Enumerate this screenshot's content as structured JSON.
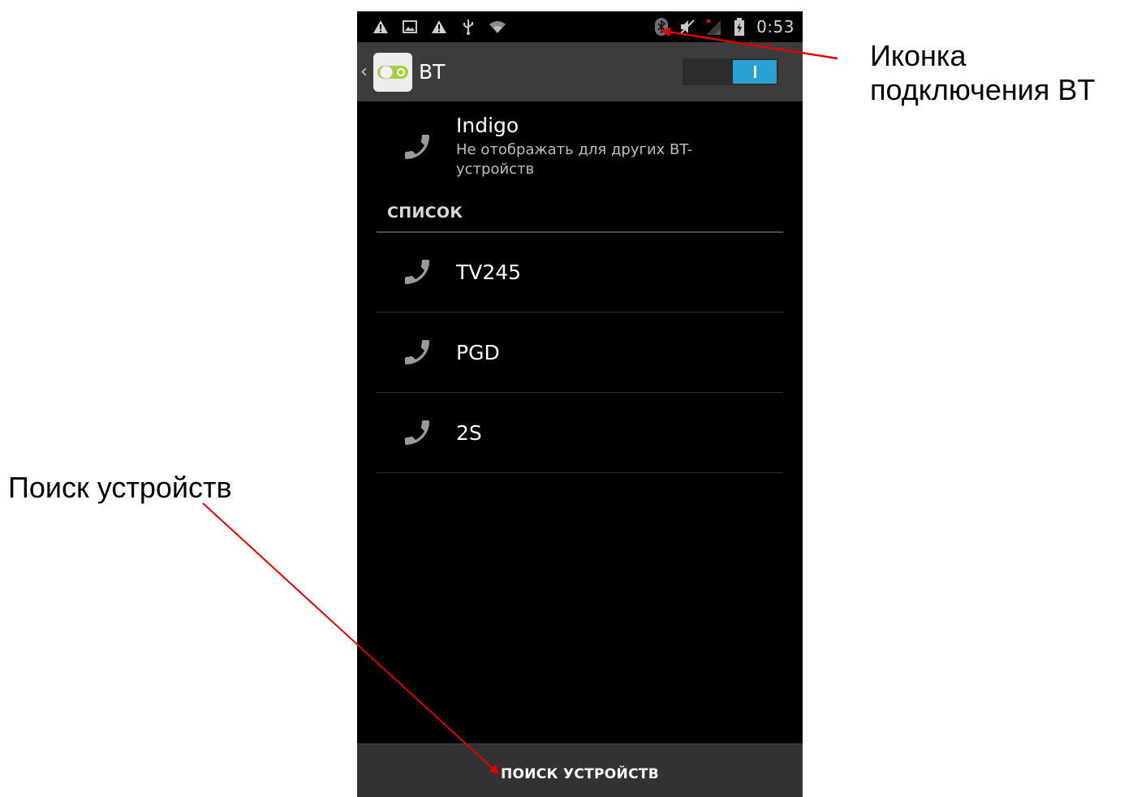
{
  "status_bar": {
    "time": "0:53",
    "left_icons": [
      "warning-icon",
      "image-icon",
      "warning-icon",
      "usb-icon",
      "wifi-icon"
    ],
    "right_icons": [
      "bluetooth-icon",
      "mute-icon",
      "no-signal-icon",
      "battery-charging-icon"
    ]
  },
  "action_bar": {
    "title": "BT",
    "toggle_on": true
  },
  "own_device": {
    "name": "Indigo",
    "subtitle": "Не отображать для других BT-устройств"
  },
  "list": {
    "header": "СПИСОК",
    "devices": [
      {
        "name": "TV245"
      },
      {
        "name": "PGD"
      },
      {
        "name": "2S"
      }
    ]
  },
  "bottom_bar": {
    "search_label": "ПОИСК УСТРОЙСТВ"
  },
  "annotations": {
    "bt_icon_label": "Иконка подключения BT",
    "search_label": "Поиск устройств"
  },
  "colors": {
    "accent": "#2aa1d3",
    "annotation_arrow": "#e00000",
    "action_bar": "#3c3c3c",
    "screen_bg": "#000000"
  }
}
